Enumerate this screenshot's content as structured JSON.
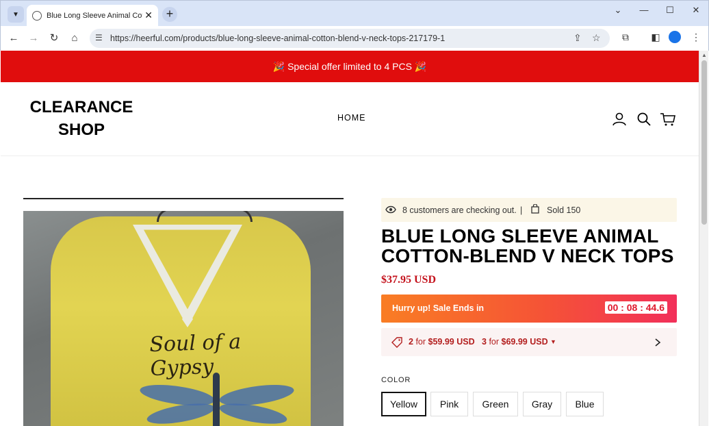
{
  "browser": {
    "tab_title": "Blue Long Sleeve Animal Cotton-Blend V Neck Tops",
    "url": "https://heerful.com/products/blue-long-sleeve-animal-cotton-blend-v-neck-tops-217179-1"
  },
  "announcement": {
    "text": "🎉 Special offer limited to 4 PCS 🎉",
    "bg_color": "#e00d0d"
  },
  "header": {
    "logo_line1": "CLEARANCE",
    "logo_line2": "SHOP",
    "nav": [
      "HOME"
    ]
  },
  "product": {
    "image_text": "Soul of a Gypsy",
    "social_checking": "8 customers are checking out.",
    "social_divider": "|",
    "social_sold": "Sold 150",
    "title": "BLUE LONG SLEEVE ANIMAL COTTON-BLEND V NECK TOPS",
    "price": "$37.95 USD",
    "timer_label": "Hurry up! Sale Ends in",
    "timer_value": "00 : 08 : 44.6",
    "bundle_1_qty": "2",
    "bundle_1_for": "for",
    "bundle_1_price": "$59.99 USD",
    "bundle_2_qty": "3",
    "bundle_2_for": "for",
    "bundle_2_price": "$69.99 USD",
    "color_label": "COLOR",
    "colors": [
      "Yellow",
      "Pink",
      "Green",
      "Gray",
      "Blue"
    ],
    "selected_color": "Yellow",
    "price_color": "#c4121c"
  },
  "icons": {
    "account": "user-icon",
    "search": "search-icon",
    "cart": "cart-icon"
  }
}
